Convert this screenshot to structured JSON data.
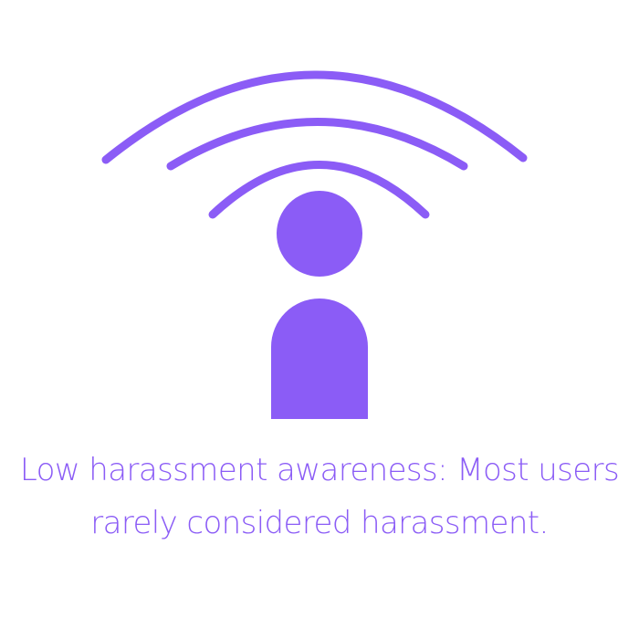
{
  "caption": {
    "line1": "Low harassment awareness: Most users",
    "line2": "rarely considered harassment."
  },
  "icon": {
    "name": "person-signal-icon",
    "color": "#8b5cf6"
  }
}
